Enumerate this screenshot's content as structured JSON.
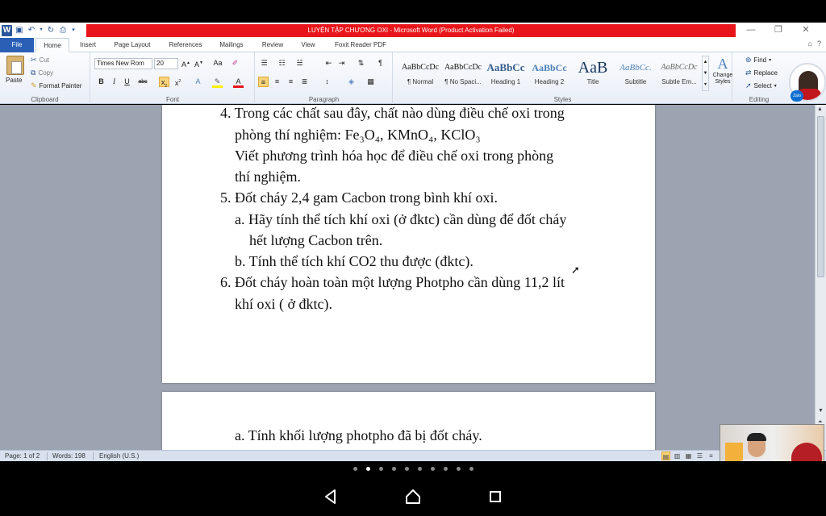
{
  "window": {
    "title": "LUYỆN TẬP CHƯƠNG OXI  -  Microsoft Word (Product Activation Failed)",
    "controls": [
      "minimize-icon",
      "restore-icon",
      "close-icon"
    ],
    "title_bar_color": "#e8161b"
  },
  "tabs": [
    "File",
    "Home",
    "Insert",
    "Page Layout",
    "References",
    "Mailings",
    "Review",
    "View",
    "Foxit Reader PDF"
  ],
  "active_tab": "Home",
  "ribbon": {
    "clipboard": {
      "label": "Clipboard",
      "paste": "Paste",
      "cut": "Cut",
      "copy": "Copy",
      "format_painter": "Format Painter"
    },
    "font": {
      "label": "Font",
      "font_name": "Times New Rom",
      "font_size": "20",
      "change_case": "Aa"
    },
    "paragraph": {
      "label": "Paragraph"
    },
    "styles": {
      "label": "Styles",
      "items": [
        {
          "sample": "AaBbCcDc",
          "name": "¶ Normal"
        },
        {
          "sample": "AaBbCcDc",
          "name": "¶ No Spaci..."
        },
        {
          "sample": "AaBbCc",
          "name": "Heading 1"
        },
        {
          "sample": "AaBbCc",
          "name": "Heading 2"
        },
        {
          "sample": "AaB",
          "name": "Title"
        },
        {
          "sample": "AaBbCc.",
          "name": "Subtitle"
        },
        {
          "sample": "AaBbCcDc",
          "name": "Subtle Em..."
        }
      ],
      "change_styles": "Change Styles"
    },
    "editing": {
      "label": "Editing",
      "find": "Find",
      "replace": "Replace",
      "select": "Select"
    }
  },
  "document": {
    "page1": [
      "4. Trong các chất sau đây, chất nào dùng điều chế oxi trong",
      "phòng thí nghiệm: Fe₃O₄, KMnO₄, KClO₃",
      "Viết phương trình hóa học để điều chế oxi trong phòng",
      "thí nghiệm.",
      "5. Đốt cháy 2,4 gam Cacbon trong bình khí oxi.",
      "a. Hãy tính thể tích khí oxi (ở đktc) cần dùng để đốt cháy",
      "hết lượng Cacbon trên.",
      "b. Tính thể tích khí CO2 thu được (đktc).",
      "6. Đốt cháy hoàn toàn một lượng Photpho cần dùng 11,2 lít",
      "khí oxi ( ở đktc)."
    ],
    "page2": [
      "a. Tính khối lượng photpho đã bị đốt cháy."
    ]
  },
  "status": {
    "page": "Page: 1 of 2",
    "words": "Words: 198",
    "language": "English (U.S.)"
  },
  "overlay": {
    "zalo_badge": "Zalo"
  },
  "carousel": {
    "count": 10,
    "active_index": 1
  }
}
